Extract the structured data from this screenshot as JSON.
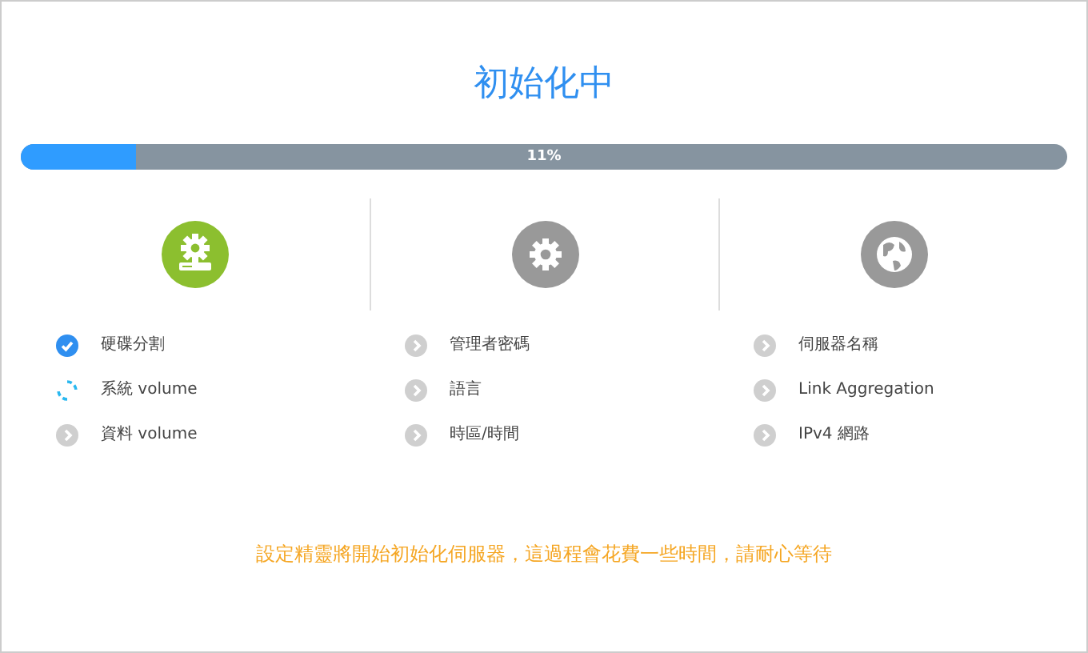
{
  "title": "初始化中",
  "progress": {
    "level": 0.11,
    "reading": "11%"
  },
  "sections": [
    {
      "kind": "server",
      "active": true,
      "steps": [
        {
          "label": "硬碟分割",
          "kind": "done"
        },
        {
          "label": "系統 volume",
          "kind": "running"
        },
        {
          "label": "資料 volume",
          "kind": "pending"
        }
      ]
    },
    {
      "kind": "settings",
      "active": false,
      "steps": [
        {
          "label": "管理者密碼",
          "kind": "pending"
        },
        {
          "label": "語言",
          "kind": "pending"
        },
        {
          "label": "時區/時間",
          "kind": "pending"
        }
      ]
    },
    {
      "kind": "network",
      "active": false,
      "steps": [
        {
          "label": "伺服器名稱",
          "kind": "pending"
        },
        {
          "label": "Link Aggregation",
          "kind": "pending"
        },
        {
          "label": "IPv4 網路",
          "kind": "pending"
        }
      ]
    }
  ],
  "footer": "設定精靈將開始初始化伺服器，這過程會花費一些時間，請耐心等待"
}
